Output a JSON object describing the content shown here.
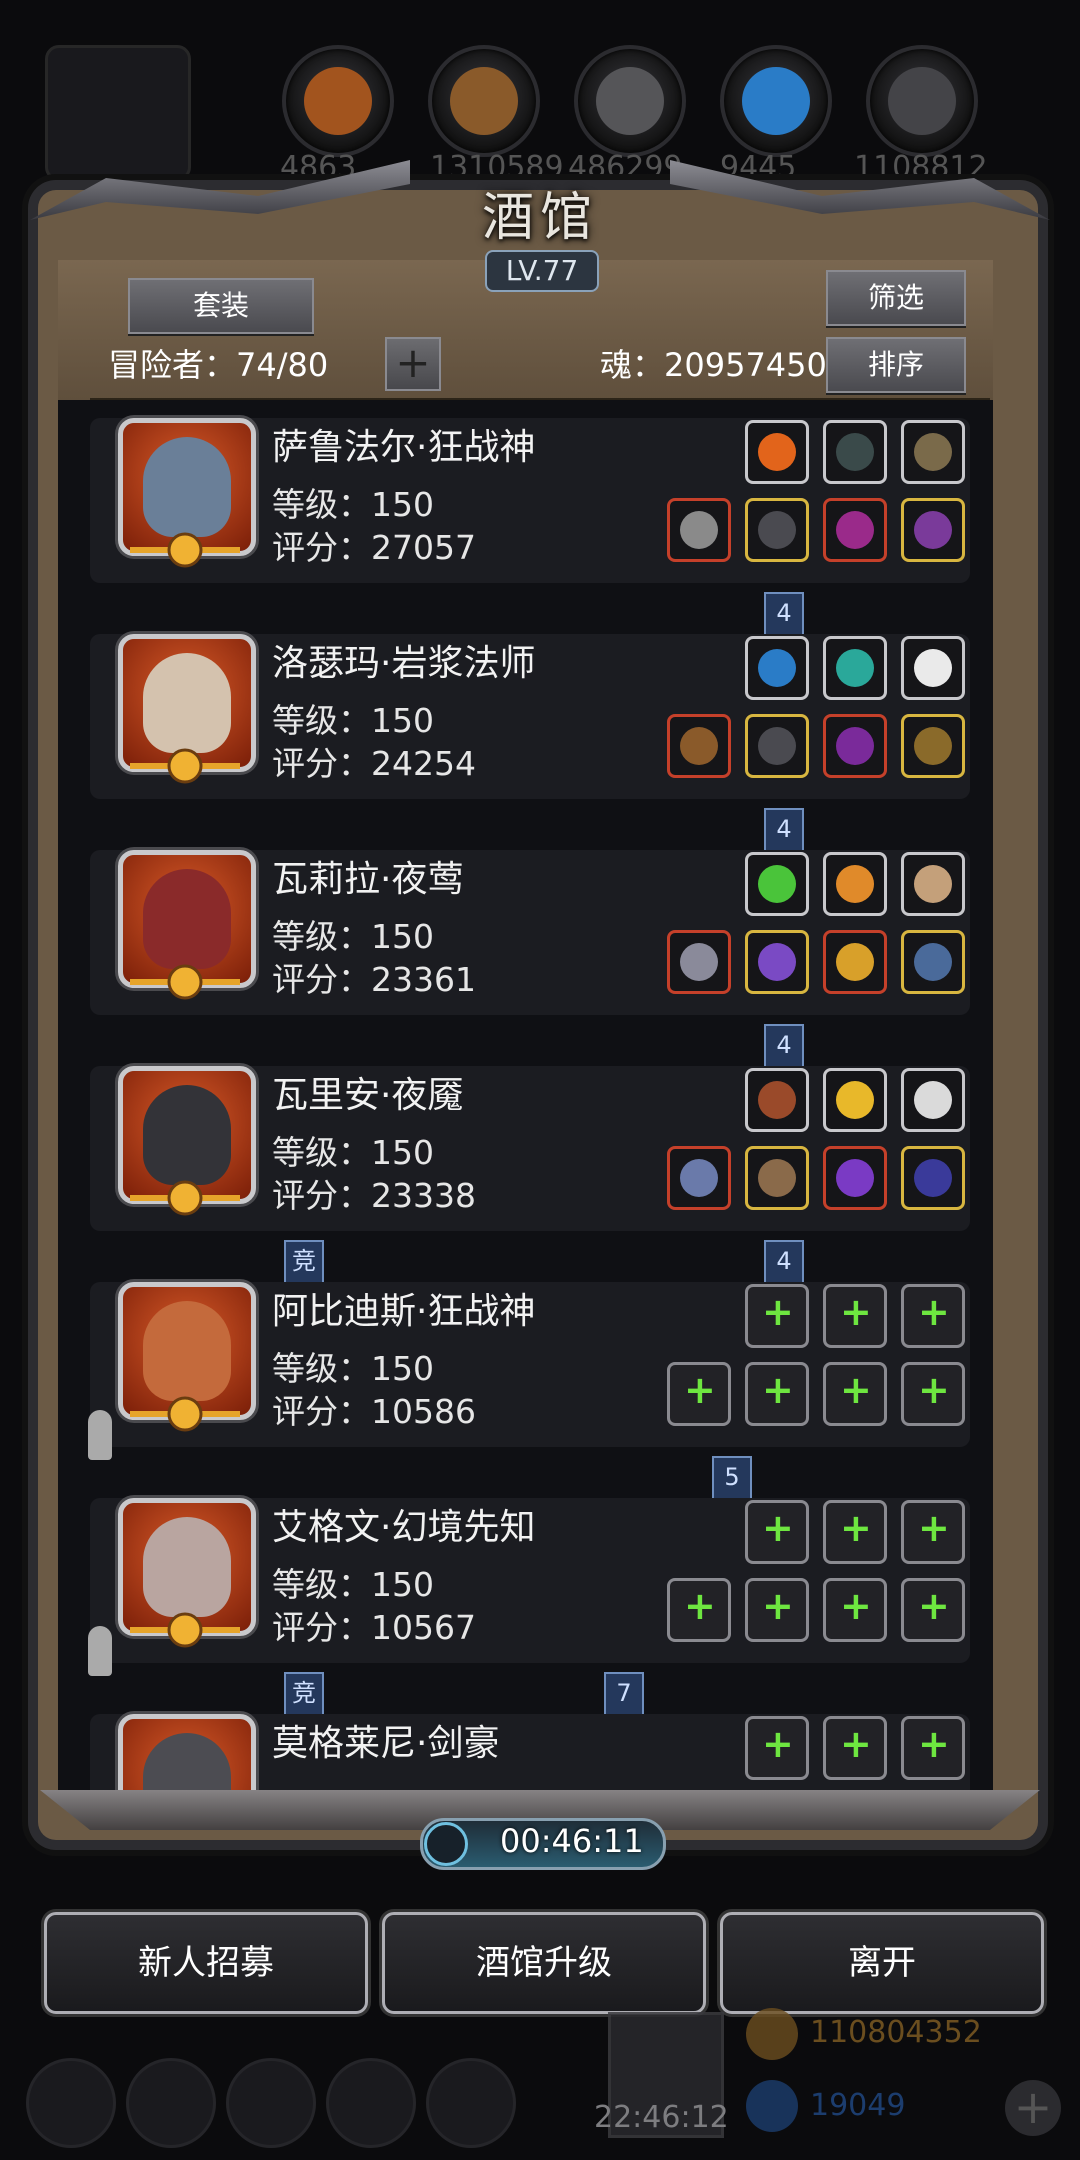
{
  "top_bar": {
    "resources": [
      {
        "icon": "meat-icon",
        "color": "#a2541e",
        "value": "4863"
      },
      {
        "icon": "wood-icon",
        "color": "#8a5a2a",
        "value": "1310589"
      },
      {
        "icon": "iron-icon",
        "color": "#555558",
        "value": "486299"
      },
      {
        "icon": "crystal-icon",
        "color": "#2a7cc7",
        "value": "9445"
      },
      {
        "icon": "metal-icon",
        "color": "#444448",
        "value": "1108812"
      }
    ]
  },
  "panel": {
    "title": "酒馆",
    "level": "LV.77",
    "suit_button": "套装",
    "filter_button": "筛选",
    "sort_button": "排序",
    "adventurers_label": "冒险者：74/80",
    "add_label": "+",
    "soul_label": "魂：20957450"
  },
  "heroes": [
    {
      "name": "萨鲁法尔·狂战神",
      "level": "等级：150",
      "score": "评分：27057",
      "tags": [
        "4"
      ],
      "portrait_color": "#6a7f98"
    },
    {
      "name": "洛瑟玛·岩浆法师",
      "level": "等级：150",
      "score": "评分：24254",
      "tags": [
        "4"
      ],
      "portrait_color": "#d4c2ae"
    },
    {
      "name": "瓦莉拉·夜莺",
      "level": "等级：150",
      "score": "评分：23361",
      "tags": [
        "4"
      ],
      "portrait_color": "#8a2a2a"
    },
    {
      "name": "瓦里安·夜魇",
      "level": "等级：150",
      "score": "评分：23338",
      "tags": [
        "竞",
        "4"
      ],
      "portrait_color": "#333338"
    },
    {
      "name": "阿比迪斯·狂战神",
      "level": "等级：150",
      "score": "评分：10586",
      "tags": [
        "5"
      ],
      "portrait_color": "#c46a3c"
    },
    {
      "name": "艾格文·幻境先知",
      "level": "等级：150",
      "score": "评分：10567",
      "tags": [
        "竞",
        "7"
      ],
      "portrait_color": "#b9a5a0"
    },
    {
      "name": "莫格莱尼·剑豪",
      "level": "",
      "score": "",
      "tags": [],
      "portrait_color": "#4c4c52"
    }
  ],
  "timer": "00:46:11",
  "actions": {
    "recruit": "新人招募",
    "upgrade": "酒馆升级",
    "leave": "离开"
  },
  "footer": {
    "clock": "22:46:12",
    "gold": "110804352",
    "gems": "19049",
    "add": "+"
  }
}
